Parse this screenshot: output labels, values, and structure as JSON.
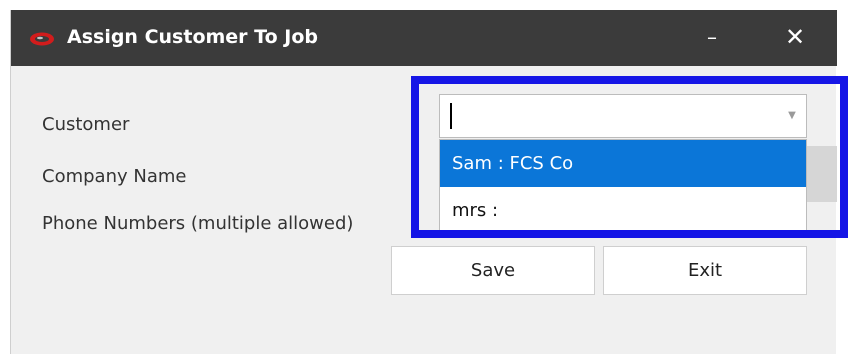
{
  "window": {
    "title": "Assign Customer To Job",
    "minimize_label": "–",
    "close_label": "✕",
    "icon": "red-oval-app-icon"
  },
  "form": {
    "customer_label": "Customer",
    "company_label": "Company Name",
    "phone_label": "Phone Numbers (multiple allowed)",
    "customer_value": ""
  },
  "dropdown": {
    "options": [
      "Sam : FCS Co",
      "mrs :"
    ],
    "selected_index": 0
  },
  "buttons": {
    "save_label": "Save",
    "exit_label": "Exit"
  },
  "colors": {
    "highlight_border": "#1515e6",
    "selection": "#0b76d8",
    "titlebar": "#3b3b3b"
  }
}
